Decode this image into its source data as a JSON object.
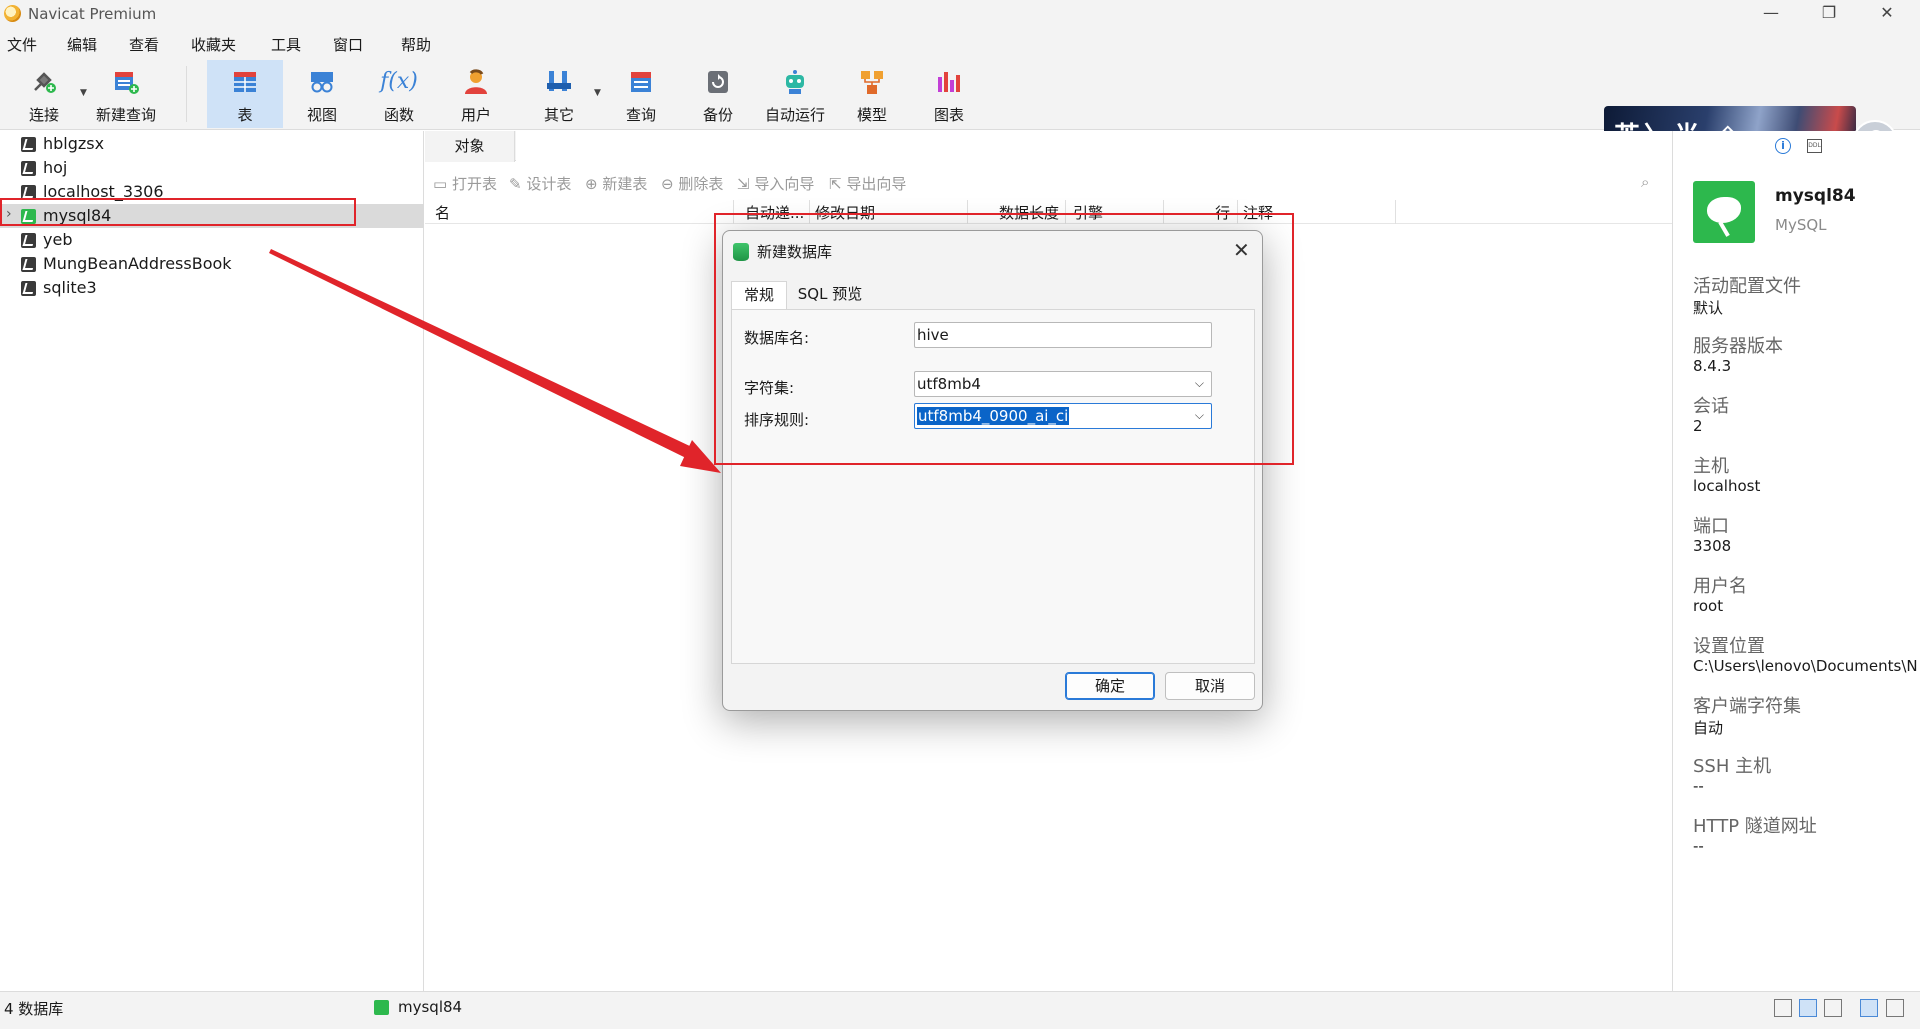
{
  "window": {
    "title": "Navicat Premium",
    "minimize": "—",
    "restore": "❐",
    "close": "✕"
  },
  "menu": [
    "文件",
    "编辑",
    "查看",
    "收藏夹",
    "工具",
    "窗口",
    "帮助"
  ],
  "toolbar": {
    "items": [
      {
        "label": "连接",
        "icon": "plug-icon"
      },
      {
        "label": "新建查询",
        "icon": "new-query-icon"
      },
      {
        "label": "表",
        "icon": "table-icon"
      },
      {
        "label": "视图",
        "icon": "view-icon"
      },
      {
        "label": "函数",
        "icon": "function-icon",
        "glyph": "f(x)"
      },
      {
        "label": "用户",
        "icon": "user-icon"
      },
      {
        "label": "其它",
        "icon": "tools-icon"
      },
      {
        "label": "查询",
        "icon": "query-icon"
      },
      {
        "label": "备份",
        "icon": "backup-icon"
      },
      {
        "label": "自动运行",
        "icon": "robot-icon"
      },
      {
        "label": "模型",
        "icon": "model-icon"
      },
      {
        "label": "图表",
        "icon": "chart-icon"
      }
    ],
    "banner_text": "英〉半 ⇪"
  },
  "connections": [
    {
      "name": "hblgzsx"
    },
    {
      "name": "hoj"
    },
    {
      "name": "localhost_3306"
    },
    {
      "name": "mysql84"
    },
    {
      "name": "yeb"
    },
    {
      "name": "MungBeanAddressBook"
    },
    {
      "name": "sqlite3"
    }
  ],
  "center": {
    "object_tab": "对象",
    "actions": [
      "打开表",
      "设计表",
      "新建表",
      "删除表",
      "导入向导",
      "导出向导"
    ],
    "columns": [
      "名",
      "自动递...",
      "修改日期",
      "数据长度",
      "引擎",
      "行",
      "注释"
    ]
  },
  "info_panel": {
    "name": "mysql84",
    "type": "MySQL",
    "info_icon": "i",
    "ddl_icon": "DDL",
    "fields": [
      {
        "label": "活动配置文件",
        "value": "默认"
      },
      {
        "label": "服务器版本",
        "value": "8.4.3"
      },
      {
        "label": "会话",
        "value": "2"
      },
      {
        "label": "主机",
        "value": "localhost"
      },
      {
        "label": "端口",
        "value": "3308"
      },
      {
        "label": "用户名",
        "value": "root"
      },
      {
        "label": "设置位置",
        "value": "C:\\Users\\lenovo\\Documents\\N"
      },
      {
        "label": "客户端字符集",
        "value": "自动"
      },
      {
        "label": "SSH 主机",
        "value": "--"
      },
      {
        "label": "HTTP 隧道网址",
        "value": "--"
      }
    ]
  },
  "status": {
    "db_count": "4 数据库",
    "connection": "mysql84"
  },
  "dialog": {
    "title": "新建数据库",
    "tabs": [
      "常规",
      "SQL 预览"
    ],
    "db_name_label": "数据库名:",
    "db_name_value": "hive",
    "charset_label": "字符集:",
    "charset_value": "utf8mb4",
    "collation_label": "排序规则:",
    "collation_value": "utf8mb4_0900_ai_ci",
    "ok": "确定",
    "cancel": "取消"
  },
  "colors": {
    "accent": "#2a7ad8",
    "annotation_red": "#e0242a",
    "mysql_green": "#2db84d",
    "active_tool": "#cfe2f7"
  }
}
